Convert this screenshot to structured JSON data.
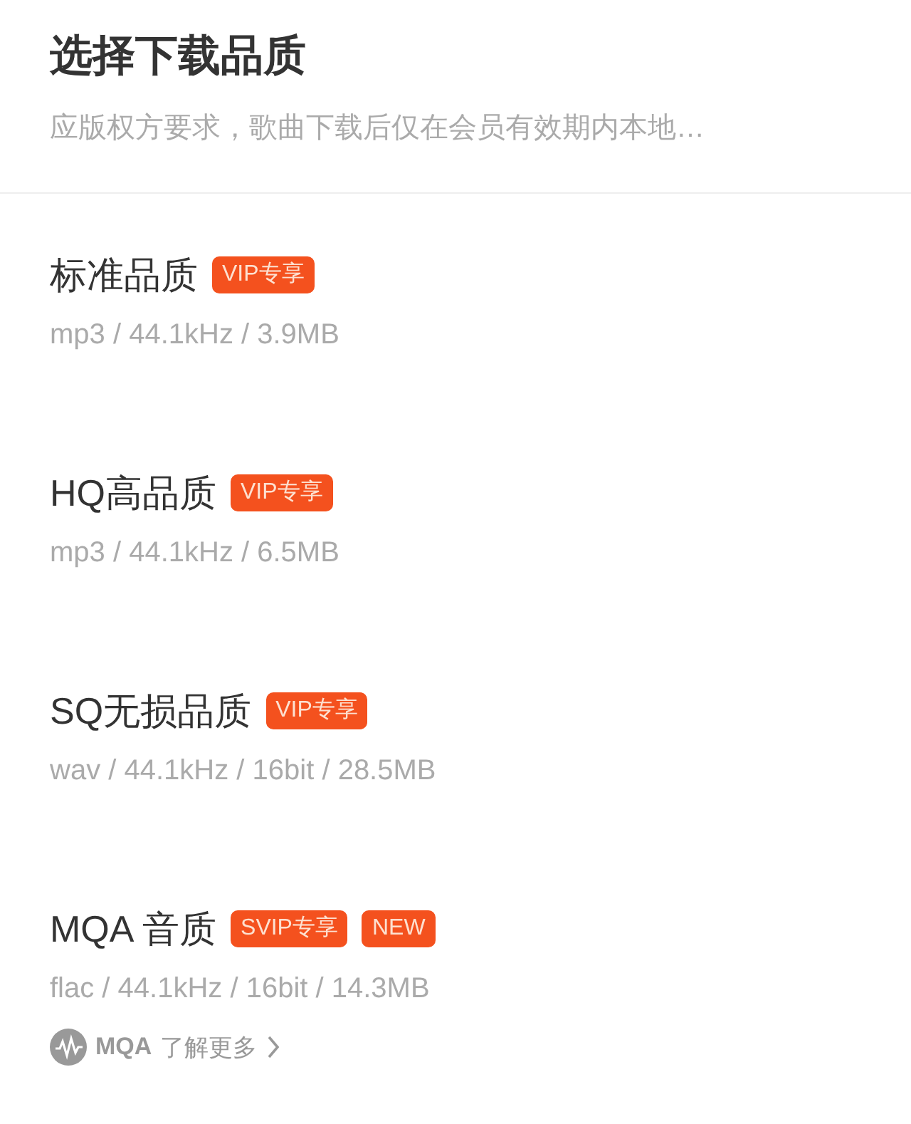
{
  "header": {
    "title": "选择下载品质",
    "subtitle": "应版权方要求，歌曲下载后仅在会员有效期内本地…"
  },
  "options": [
    {
      "name": "标准品质",
      "badges": [
        "VIP专享"
      ],
      "spec": "mp3 / 44.1kHz / 3.9MB"
    },
    {
      "name": "HQ高品质",
      "badges": [
        "VIP专享"
      ],
      "spec": "mp3 / 44.1kHz / 6.5MB"
    },
    {
      "name": "SQ无损品质",
      "badges": [
        "VIP专享"
      ],
      "spec": "wav / 44.1kHz / 16bit / 28.5MB"
    },
    {
      "name": "MQA 音质",
      "badges": [
        "SVIP专享",
        "NEW"
      ],
      "spec": "flac / 44.1kHz / 16bit / 14.3MB",
      "more": {
        "logo_text": "MQA",
        "link": "了解更多"
      }
    }
  ]
}
